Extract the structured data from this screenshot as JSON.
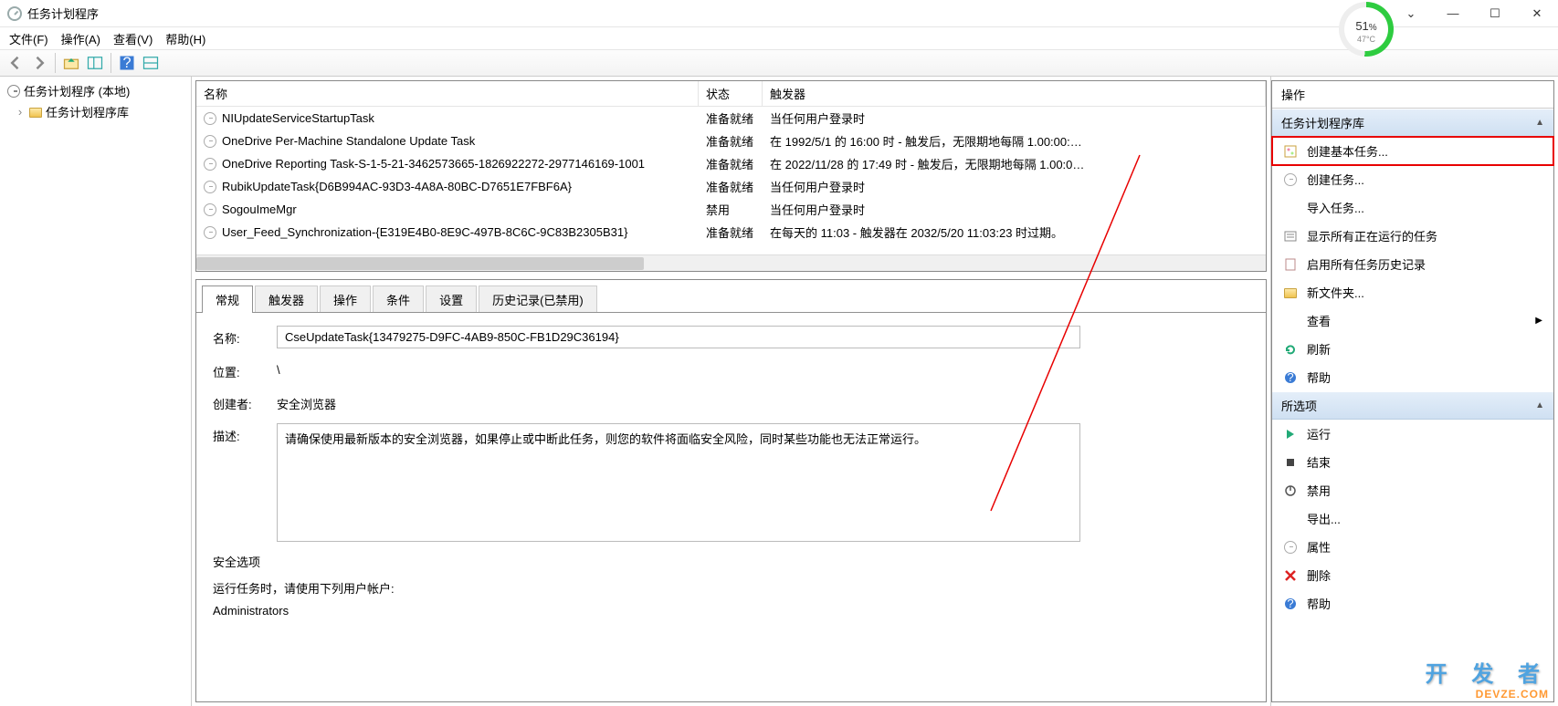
{
  "window": {
    "title": "任务计划程序",
    "perf_percent": "51",
    "perf_percent_suffix": "%",
    "perf_temp": "47°C"
  },
  "menu": {
    "file": "文件(F)",
    "action": "操作(A)",
    "view": "查看(V)",
    "help": "帮助(H)"
  },
  "tree": {
    "root": "任务计划程序 (本地)",
    "lib": "任务计划程序库"
  },
  "task_headers": {
    "name": "名称",
    "status": "状态",
    "trigger": "触发器"
  },
  "tasks": [
    {
      "name": "NIUpdateServiceStartupTask",
      "status": "准备就绪",
      "trigger": "当任何用户登录时"
    },
    {
      "name": "OneDrive Per-Machine Standalone Update Task",
      "status": "准备就绪",
      "trigger": "在 1992/5/1 的 16:00 时 - 触发后，无限期地每隔 1.00:00:…"
    },
    {
      "name": "OneDrive Reporting Task-S-1-5-21-3462573665-1826922272-2977146169-1001",
      "status": "准备就绪",
      "trigger": "在 2022/11/28 的 17:49 时 - 触发后，无限期地每隔 1.00:0…"
    },
    {
      "name": "RubikUpdateTask{D6B994AC-93D3-4A8A-80BC-D7651E7FBF6A}",
      "status": "准备就绪",
      "trigger": "当任何用户登录时"
    },
    {
      "name": "SogouImeMgr",
      "status": "禁用",
      "trigger": "当任何用户登录时"
    },
    {
      "name": "User_Feed_Synchronization-{E319E4B0-8E9C-497B-8C6C-9C83B2305B31}",
      "status": "准备就绪",
      "trigger": "在每天的 11:03 - 触发器在 2032/5/20 11:03:23 时过期。"
    }
  ],
  "tabs": {
    "general": "常规",
    "triggers": "触发器",
    "actions": "操作",
    "conditions": "条件",
    "settings": "设置",
    "history": "历史记录(已禁用)"
  },
  "details": {
    "labels": {
      "name": "名称:",
      "location": "位置:",
      "creator": "创建者:",
      "description": "描述:"
    },
    "name": "CseUpdateTask{13479275-D9FC-4AB9-850C-FB1D29C36194}",
    "location": "\\",
    "creator": "安全浏览器",
    "description": "请确保使用最新版本的安全浏览器，如果停止或中断此任务，则您的软件将面临安全风险，同时某些功能也无法正常运行。",
    "security_header": "安全选项",
    "security_sub": "运行任务时，请使用下列用户帐户:",
    "security_account": "Administrators"
  },
  "actions_panel": {
    "title": "操作",
    "section_lib": "任务计划程序库",
    "section_selected": "所选项",
    "lib_items": {
      "create_basic": "创建基本任务...",
      "create": "创建任务...",
      "import": "导入任务...",
      "show_running": "显示所有正在运行的任务",
      "enable_history": "启用所有任务历史记录",
      "new_folder": "新文件夹...",
      "view": "查看",
      "refresh": "刷新",
      "help": "帮助"
    },
    "sel_items": {
      "run": "运行",
      "end": "结束",
      "disable": "禁用",
      "export": "导出...",
      "properties": "属性",
      "delete": "删除",
      "help": "帮助"
    }
  },
  "watermark": {
    "line1": "开 发 者",
    "line2": "DEVZE.COM"
  }
}
